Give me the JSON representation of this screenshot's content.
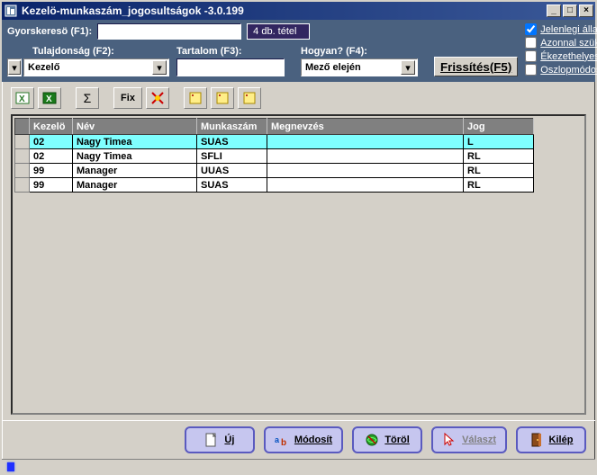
{
  "window": {
    "title": "Kezelö-munkaszám_jogosultságok -3.0.199"
  },
  "quicksearch": {
    "label": "Gyorskeresö (F1):",
    "value": "",
    "count_text": "4 db. tétel"
  },
  "checks": {
    "current": "Jelenlegi állapot",
    "narrow": "Azonnal szükít",
    "accent": "Ékezethelyes",
    "columns": "Oszlopmódosítás"
  },
  "filters": {
    "property_label": "Tulajdonság (F2):",
    "property_value": "Kezelő",
    "content_label": "Tartalom (F3):",
    "content_value": "",
    "how_label": "Hogyan? (F4):",
    "how_value": "Mező elején",
    "refresh_label": "Frissítés(F5)"
  },
  "toolbar": {
    "sigma": "Σ",
    "fix": "Fix"
  },
  "grid": {
    "headers": {
      "kezelo": "Kezelö",
      "nev": "Név",
      "munkaszam": "Munkaszám",
      "megnevezes": "Megnevzés",
      "jog": "Jog"
    },
    "rows": [
      {
        "kezelo": "02",
        "nev": "Nagy Timea",
        "munkaszam": "SUAS",
        "megnevezes": "",
        "jog": "L"
      },
      {
        "kezelo": "02",
        "nev": "Nagy Timea",
        "munkaszam": "SFLI",
        "megnevezes": "",
        "jog": "RL"
      },
      {
        "kezelo": "99",
        "nev": "Manager",
        "munkaszam": "UUAS",
        "megnevezes": "",
        "jog": "RL"
      },
      {
        "kezelo": "99",
        "nev": "Manager",
        "munkaszam": "SUAS",
        "megnevezes": "",
        "jog": "RL"
      }
    ]
  },
  "actions": {
    "new": "Új",
    "modify": "Módosít",
    "delete": "Töröl",
    "select": "Választ",
    "exit": "Kilép"
  }
}
